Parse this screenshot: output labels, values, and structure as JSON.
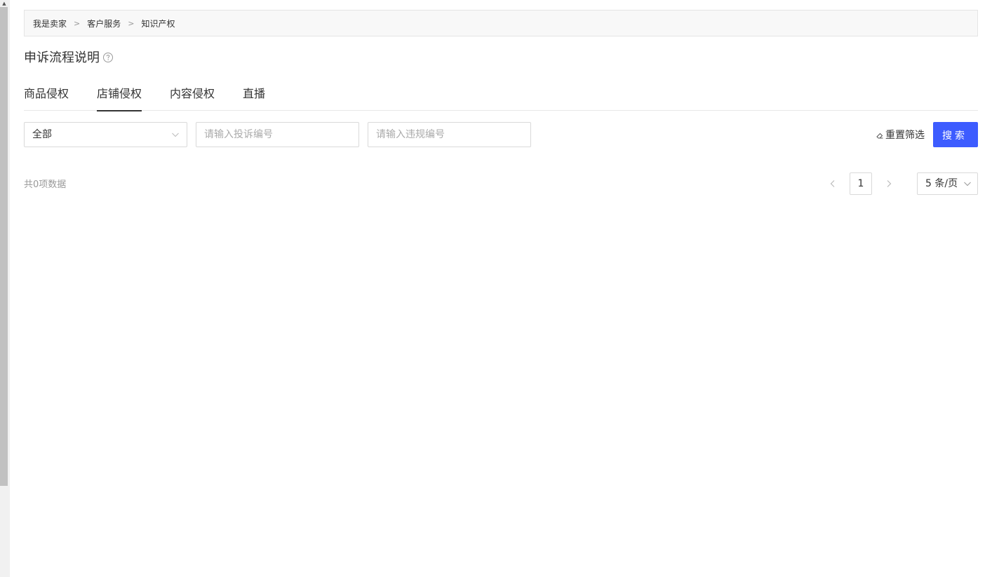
{
  "breadcrumb": {
    "items": [
      "我是卖家",
      "客户服务",
      "知识产权"
    ],
    "separator": ">"
  },
  "page": {
    "title": "申诉流程说明",
    "help_icon": "question-circle-icon"
  },
  "tabs": [
    {
      "label": "商品侵权",
      "active": false
    },
    {
      "label": "店铺侵权",
      "active": true
    },
    {
      "label": "内容侵权",
      "active": false
    },
    {
      "label": "直播",
      "active": false
    }
  ],
  "filters": {
    "status_select": {
      "value": "全部"
    },
    "complaint_no": {
      "placeholder": "请输入投诉编号",
      "value": ""
    },
    "violation_no": {
      "placeholder": "请输入违规编号",
      "value": ""
    },
    "reset_label": "重置筛选",
    "search_label": "搜索"
  },
  "results": {
    "total_text": "共0项数据"
  },
  "pagination": {
    "current_page": "1",
    "page_size": "5 条/页"
  },
  "colors": {
    "primary": "#3d5cff",
    "border": "#d9d9d9",
    "breadcrumb_bg": "#f8f8f8",
    "scrollbar_thumb": "#c1c1c1"
  }
}
